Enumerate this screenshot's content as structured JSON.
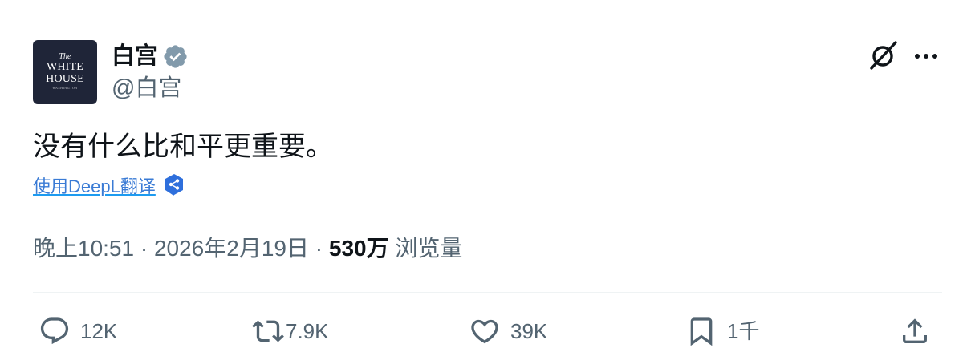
{
  "author": {
    "display_name": "白宫",
    "handle": "@白宫",
    "avatar_lines": [
      "The",
      "WHITE",
      "HOUSE",
      "WASHINGTON"
    ]
  },
  "tweet": {
    "text": "没有什么比和平更重要。",
    "translate_label": "使用DeepL翻译"
  },
  "meta": {
    "time": "晚上10:51",
    "separator": " · ",
    "date": "2026年2月19日",
    "views_count": "530万",
    "views_label": "浏览量"
  },
  "actions": {
    "reply_count": "12K",
    "repost_count": "7.9K",
    "like_count": "39K",
    "bookmark_count": "1千"
  },
  "icons": {
    "verified": "verified-badge-icon",
    "grok": "grok-icon",
    "more": "more-icon",
    "deepl": "deepl-icon",
    "reply": "reply-icon",
    "repost": "repost-icon",
    "like": "heart-icon",
    "bookmark": "bookmark-icon",
    "share": "share-icon"
  },
  "colors": {
    "text_primary": "#0f1419",
    "text_secondary": "#536471",
    "link": "#3a7bd5",
    "avatar_bg": "#1f2538",
    "verified_badge": "#829aab",
    "deepl": "#2e6fdc"
  }
}
